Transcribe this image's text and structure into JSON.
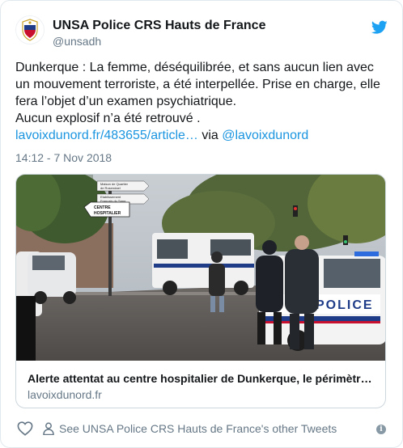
{
  "author": {
    "name": "UNSA Police CRS Hauts de France",
    "handle": "@unsadh"
  },
  "tweet": {
    "line1": "Dunkerque : La femme, déséquilibrée, et sans aucun lien avec un mouvement terroriste, a été interpellée. Prise en charge, elle fera l’objet d’un examen psychiatrique.",
    "line2": "Aucun explosif n’a été retrouvé .",
    "link_text": "lavoixdunord.fr/483655/article…",
    "via_text": " via ",
    "mention": "@lavoixdunord",
    "timestamp": "14:12 - 7 Nov 2018"
  },
  "card": {
    "title": "Alerte attentat au centre hospitalier de Dunkerque, le périmètre de sécurité levé",
    "domain": "lavoixdunord.fr",
    "image_signs": {
      "sign1_line1": "Maison de Quartier",
      "sign1_line2": "de Rosendael",
      "sign2_line1": "Etablissement",
      "sign2_line2": "Français du Sang",
      "sign3_line1": "CENTRE",
      "sign3_line2": "HOSPITALIER",
      "police_text": "POLICE"
    }
  },
  "footer": {
    "see_more": "See UNSA Police CRS Hauts de France's other Tweets",
    "info_glyph": "i"
  },
  "colors": {
    "link": "#1b95e0",
    "secondary": "#657786",
    "twitter_blue": "#1da1f2"
  }
}
